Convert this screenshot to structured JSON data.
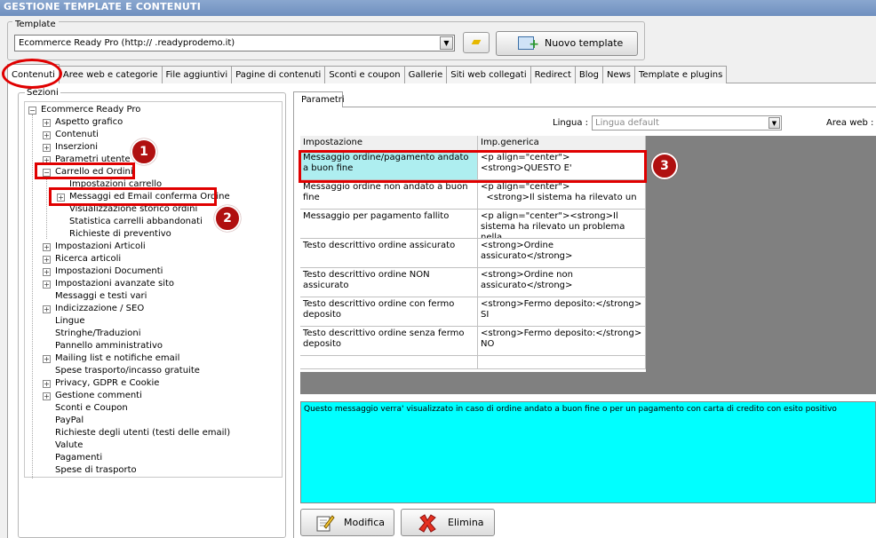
{
  "window": {
    "title": "GESTIONE TEMPLATE E CONTENUTI"
  },
  "template": {
    "group_label": "Template",
    "selected": "Ecommerce Ready Pro (http://        .readyprodemo.it)",
    "new_button": "Nuovo template"
  },
  "tabs": [
    "Contenuti",
    "Aree web e categorie",
    "File aggiuntivi",
    "Pagine di contenuti",
    "Sconti e coupon",
    "Gallerie",
    "Siti web collegati",
    "Redirect",
    "Blog",
    "News",
    "Template e plugins"
  ],
  "sections": {
    "label": "Sezioni",
    "tree": [
      {
        "label": "Ecommerce Ready Pro",
        "level": 0,
        "toggle": "-"
      },
      {
        "label": "Aspetto grafico",
        "level": 1,
        "toggle": "+"
      },
      {
        "label": "Contenuti",
        "level": 1,
        "toggle": "+"
      },
      {
        "label": "Inserzioni",
        "level": 1,
        "toggle": "+"
      },
      {
        "label": "Parametri utente",
        "level": 1,
        "toggle": "+"
      },
      {
        "label": "Carrello ed Ordini",
        "level": 1,
        "toggle": "-"
      },
      {
        "label": "Impostazioni carrello",
        "level": 2,
        "toggle": ""
      },
      {
        "label": "Messaggi ed Email conferma Ordine",
        "level": 2,
        "toggle": "+"
      },
      {
        "label": "Visualizzazione storico ordini",
        "level": 2,
        "toggle": ""
      },
      {
        "label": "Statistica carrelli abbandonati",
        "level": 2,
        "toggle": ""
      },
      {
        "label": "Richieste di preventivo",
        "level": 2,
        "toggle": ""
      },
      {
        "label": "Impostazioni Articoli",
        "level": 1,
        "toggle": "+"
      },
      {
        "label": "Ricerca articoli",
        "level": 1,
        "toggle": "+"
      },
      {
        "label": "Impostazioni Documenti",
        "level": 1,
        "toggle": "+"
      },
      {
        "label": "Impostazioni avanzate sito",
        "level": 1,
        "toggle": "+"
      },
      {
        "label": "Messaggi e testi vari",
        "level": 1,
        "toggle": ""
      },
      {
        "label": "Indicizzazione / SEO",
        "level": 1,
        "toggle": "+"
      },
      {
        "label": "Lingue",
        "level": 1,
        "toggle": ""
      },
      {
        "label": "Stringhe/Traduzioni",
        "level": 1,
        "toggle": ""
      },
      {
        "label": "Pannello amministrativo",
        "level": 1,
        "toggle": ""
      },
      {
        "label": "Mailing list e notifiche email",
        "level": 1,
        "toggle": "+"
      },
      {
        "label": "Spese trasporto/incasso gratuite",
        "level": 1,
        "toggle": ""
      },
      {
        "label": "Privacy, GDPR e Cookie",
        "level": 1,
        "toggle": "+"
      },
      {
        "label": "Gestione commenti",
        "level": 1,
        "toggle": "+"
      },
      {
        "label": "Sconti e Coupon",
        "level": 1,
        "toggle": ""
      },
      {
        "label": "PayPal",
        "level": 1,
        "toggle": ""
      },
      {
        "label": "Richieste degli utenti (testi delle email)",
        "level": 1,
        "toggle": ""
      },
      {
        "label": "Valute",
        "level": 1,
        "toggle": ""
      },
      {
        "label": "Pagamenti",
        "level": 1,
        "toggle": ""
      },
      {
        "label": "Spese di trasporto",
        "level": 1,
        "toggle": ""
      }
    ]
  },
  "params": {
    "tab": "Parametri",
    "lingua_label": "Lingua :",
    "lingua_value": "Lingua default",
    "area_label": "Area web :",
    "columns": [
      "Impostazione",
      "Imp.generica"
    ],
    "rows": [
      [
        "Messaggio ordine/pagamento andato a buon fine",
        "<p align=\"center\"><strong>QUESTO E'"
      ],
      [
        "Messaggio ordine non andato a buon fine",
        "<p align=\"center\">\n  <strong>Il sistema ha rilevato un"
      ],
      [
        "Messaggio per pagamento fallito",
        "<p align=\"center\"><strong>Il sistema ha rilevato un problema nella"
      ],
      [
        "Testo descrittivo ordine assicurato",
        "<strong>Ordine assicurato</strong>"
      ],
      [
        "Testo descrittivo ordine NON assicurato",
        "<strong>Ordine non assicurato</strong>"
      ],
      [
        "Testo descrittivo ordine con fermo deposito",
        "<strong>Fermo deposito:</strong> SI"
      ],
      [
        "Testo descrittivo ordine senza fermo deposito",
        "<strong>Fermo deposito:</strong> NO"
      ]
    ],
    "description": "Questo messaggio verra' visualizzato in caso di ordine andato a buon fine o per un pagamento con carta di credito con esito positivo",
    "modify_button": "Modifica",
    "delete_button": "Elimina"
  },
  "callouts": [
    "1",
    "2",
    "3"
  ],
  "colors": {
    "highlight_cell": "#aeeef0",
    "description_bg": "#00ffff",
    "callout_red": "#e00000",
    "badge": "#b01010"
  }
}
